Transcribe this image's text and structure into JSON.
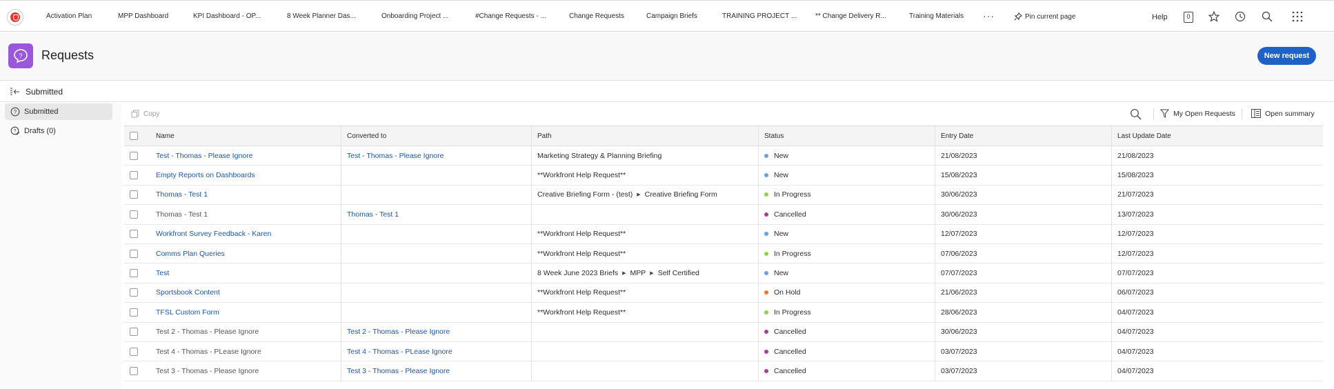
{
  "nav": {
    "items": [
      "Activation Plan",
      "MPP Dashboard",
      "KPI Dashboard - OP...",
      "8 Week Planner Das...",
      "Onboarding Project ...",
      "#Change Requests - ...",
      "Change Requests",
      "Campaign Briefs",
      "TRAINING PROJECT ...",
      "** Change Delivery R...",
      "Training Materials"
    ],
    "more": "···",
    "pin_label": "Pin current page",
    "help_label": "Help",
    "notification_count": "0"
  },
  "header": {
    "title": "Requests",
    "new_request_label": "New request"
  },
  "subheader": {
    "label": "Submitted"
  },
  "sidebar": {
    "items": [
      {
        "label": "Submitted",
        "icon": "question-circle-icon"
      },
      {
        "label": "Drafts (0)",
        "icon": "question-drafts-icon"
      }
    ]
  },
  "toolbar": {
    "copy_label": "Copy",
    "filter_label": "My Open Requests",
    "summary_label": "Open summary"
  },
  "table": {
    "columns": [
      "Name",
      "Converted to",
      "Path",
      "Status",
      "Entry Date",
      "Last Update Date"
    ],
    "status_colors": {
      "New": "#6b9fe6",
      "In Progress": "#8fd14f",
      "Cancelled": "#b03a9a",
      "On Hold": "#e8782b"
    },
    "rows": [
      {
        "name": "Test - Thomas - Please Ignore",
        "name_link": true,
        "converted": "Test - Thomas - Please Ignore",
        "path": [
          "Marketing Strategy & Planning Briefing"
        ],
        "status": "New",
        "entry": "21/08/2023",
        "updated": "21/08/2023"
      },
      {
        "name": "Empty Reports on Dashboards",
        "name_link": true,
        "converted": "",
        "path": [
          "**Workfront Help Request**"
        ],
        "status": "New",
        "entry": "15/08/2023",
        "updated": "15/08/2023"
      },
      {
        "name": "Thomas - Test 1",
        "name_link": true,
        "converted": "",
        "path": [
          "Creative Briefing Form - (test)",
          "Creative Briefing Form"
        ],
        "status": "In Progress",
        "entry": "30/06/2023",
        "updated": "21/07/2023"
      },
      {
        "name": "Thomas - Test 1",
        "name_link": false,
        "converted": "Thomas - Test 1",
        "path": [],
        "status": "Cancelled",
        "entry": "30/06/2023",
        "updated": "13/07/2023"
      },
      {
        "name": "Workfront Survey Feedback - Karen",
        "name_link": true,
        "converted": "",
        "path": [
          "**Workfront Help Request**"
        ],
        "status": "New",
        "entry": "12/07/2023",
        "updated": "12/07/2023"
      },
      {
        "name": "Comms Plan Queries",
        "name_link": true,
        "converted": "",
        "path": [
          "**Workfront Help Request**"
        ],
        "status": "In Progress",
        "entry": "07/06/2023",
        "updated": "12/07/2023"
      },
      {
        "name": "Test",
        "name_link": true,
        "converted": "",
        "path": [
          "8 Week June 2023 Briefs",
          "MPP",
          "Self Certified"
        ],
        "status": "New",
        "entry": "07/07/2023",
        "updated": "07/07/2023"
      },
      {
        "name": "Sportsbook Content",
        "name_link": true,
        "converted": "",
        "path": [
          "**Workfront Help Request**"
        ],
        "status": "On Hold",
        "entry": "21/06/2023",
        "updated": "06/07/2023"
      },
      {
        "name": "TFSL Custom Form",
        "name_link": true,
        "converted": "",
        "path": [
          "**Workfront Help Request**"
        ],
        "status": "In Progress",
        "entry": "28/06/2023",
        "updated": "04/07/2023"
      },
      {
        "name": "Test 2 - Thomas - Please Ignore",
        "name_link": false,
        "converted": "Test 2 - Thomas - Please Ignore",
        "path": [],
        "status": "Cancelled",
        "entry": "30/06/2023",
        "updated": "04/07/2023"
      },
      {
        "name": "Test 4 - Thomas - PLease Ignore",
        "name_link": false,
        "converted": "Test 4 - Thomas - PLease Ignore",
        "path": [],
        "status": "Cancelled",
        "entry": "03/07/2023",
        "updated": "04/07/2023"
      },
      {
        "name": "Test 3 - Thomas - Please Ignore",
        "name_link": false,
        "converted": "Test 3 - Thomas - Please Ignore",
        "path": [],
        "status": "Cancelled",
        "entry": "03/07/2023",
        "updated": "04/07/2023"
      }
    ]
  }
}
